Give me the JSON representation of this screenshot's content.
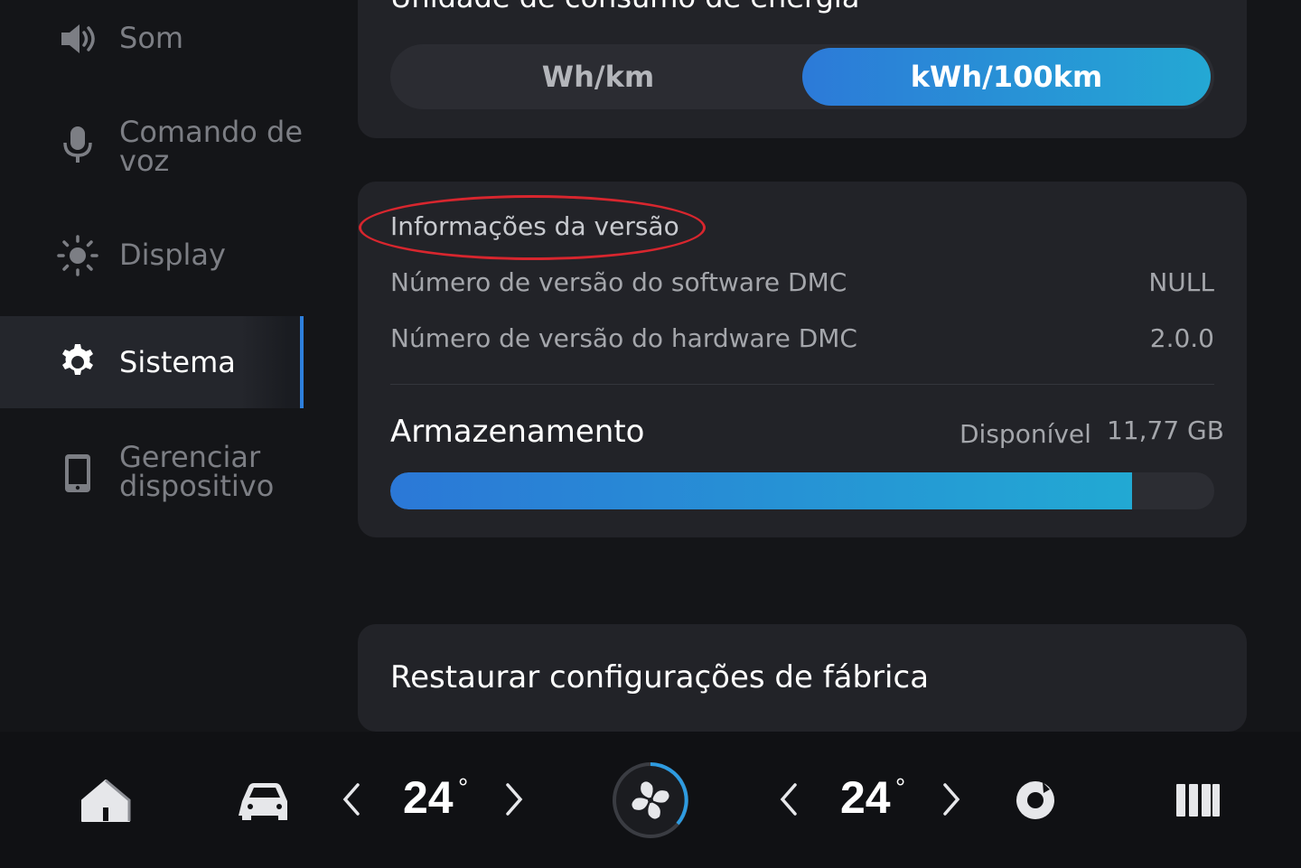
{
  "sidebar": {
    "items": [
      {
        "label": "Som",
        "icon": "speaker-icon"
      },
      {
        "label": "Comando de voz",
        "line1": "Comando de",
        "line2": "voz",
        "icon": "microphone-icon"
      },
      {
        "label": "Display",
        "icon": "sun-icon"
      },
      {
        "label": "Sistema",
        "icon": "gear-icon",
        "active": true
      },
      {
        "label": "Gerenciar dispositivo",
        "line1": "Gerenciar",
        "line2": "dispositivo",
        "icon": "phone-icon"
      }
    ]
  },
  "energy": {
    "title": "Unidade de consumo de energia",
    "options": [
      "Wh/km",
      "kWh/100km"
    ],
    "selected": "kWh/100km"
  },
  "version": {
    "title": "Informações da versão",
    "rows": [
      {
        "label": "Número de versão do software DMC",
        "value": "NULL"
      },
      {
        "label": "Número de versão do hardware DMC",
        "value": "2.0.0"
      }
    ]
  },
  "storage": {
    "title": "Armazenamento",
    "available_label": "Disponível",
    "available_value": "11,77 GB",
    "used_fraction": 0.9
  },
  "reset": {
    "label": "Restaurar configurações de fábrica"
  },
  "bottombar": {
    "left_temp": "24",
    "right_temp": "24",
    "degree_symbol": "°"
  },
  "colors": {
    "accent": "#2e7fdc",
    "accent_end": "#24a8d4",
    "annotation": "#d8262e",
    "background": "#141518",
    "card": "#222328"
  }
}
